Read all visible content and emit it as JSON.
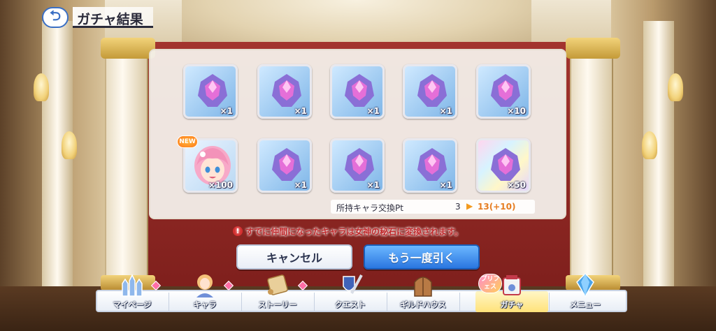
{
  "screen": {
    "back_icon": "return-arrow-icon",
    "title": "ガチャ結果"
  },
  "results": {
    "row1": [
      {
        "qty": "×1",
        "icon": "goddess-stone-icon"
      },
      {
        "qty": "×1",
        "icon": "goddess-stone-icon"
      },
      {
        "qty": "×1",
        "icon": "goddess-stone-icon"
      },
      {
        "qty": "×1",
        "icon": "goddess-stone-icon"
      },
      {
        "qty": "×10",
        "icon": "goddess-stone-icon"
      }
    ],
    "row2": [
      {
        "qty": "×100",
        "icon": "character-portrait-icon",
        "badge": "NEW"
      },
      {
        "qty": "×1",
        "icon": "goddess-stone-icon"
      },
      {
        "qty": "×1",
        "icon": "goddess-stone-icon"
      },
      {
        "qty": "×1",
        "icon": "goddess-stone-icon"
      },
      {
        "qty": "×50",
        "icon": "goddess-stone-icon"
      }
    ]
  },
  "points": {
    "label": "所持キャラ交換Pt",
    "from": "3",
    "to": "13(+10)"
  },
  "notice": {
    "icon": "!",
    "text": "すでに仲間になったキャラは女神の秘石に変換されます。"
  },
  "buttons": {
    "cancel": "キャンセル",
    "again": "もう一度引く"
  },
  "nav": {
    "items": [
      {
        "label": "マイページ",
        "icon": "castle-icon"
      },
      {
        "label": "キャラ",
        "icon": "character-icon"
      },
      {
        "label": "ストーリー",
        "icon": "scroll-icon"
      },
      {
        "label": "クエスト",
        "icon": "sword-shield-icon"
      },
      {
        "label": "ギルドハウス",
        "icon": "guild-door-icon"
      },
      {
        "label": "ガチャ",
        "icon": "gacha-icon"
      },
      {
        "label": "メニュー",
        "icon": "crystal-icon"
      }
    ],
    "active": "ガチャ",
    "prifes_badge": "プリフェス"
  },
  "colors": {
    "accent_blue": "#2a76e0",
    "notice_red": "#c0282b",
    "points_orange": "#e67e22",
    "active_nav": "#ffe27a"
  }
}
